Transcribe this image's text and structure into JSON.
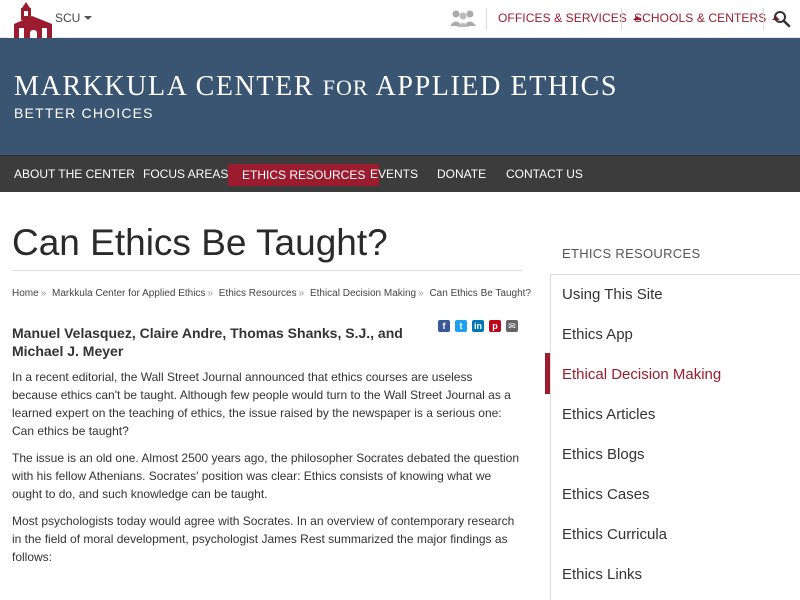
{
  "topbar": {
    "scu_label": "SCU",
    "offices_label": "OFFICES & SERVICES",
    "schools_label": "SCHOOLS & CENTERS"
  },
  "banner": {
    "title_part1": "MARKKULA CENTER ",
    "title_for": "FOR",
    "title_part2": " APPLIED ETHICS",
    "subtitle": "BETTER CHOICES"
  },
  "nav": {
    "items": [
      "ABOUT THE CENTER",
      "FOCUS AREAS",
      "ETHICS RESOURCES",
      "EVENTS",
      "DONATE",
      "CONTACT US"
    ],
    "active": "ETHICS RESOURCES"
  },
  "article": {
    "title": "Can Ethics Be Taught?",
    "breadcrumbs": [
      "Home",
      "Markkula Center for Applied Ethics",
      "Ethics Resources",
      "Ethical Decision Making",
      "Can Ethics Be Taught?"
    ],
    "authors": "Manuel Velasquez, Claire Andre, Thomas Shanks, S.J., and Michael J. Meyer",
    "paragraphs": [
      "In a recent editorial, the Wall Street Journal announced that ethics courses are useless because ethics can't be taught. Although few people would turn to the Wall Street Journal as a learned expert on the teaching of ethics, the issue raised by the newspaper is a serious one: Can ethics be taught?",
      "The issue is an old one. Almost 2500 years ago, the philosopher Socrates debated the question with his fellow Athenians. Socrates' position was clear: Ethics consists of knowing what we ought to do, and such knowledge can be taught.",
      "Most psychologists today would agree with Socrates. In an overview of contemporary research in the field of moral development, psychologist James Rest summarized the major findings as follows:"
    ]
  },
  "share_icons": [
    "facebook-icon",
    "twitter-icon",
    "linkedin-icon",
    "pinterest-icon",
    "email-icon"
  ],
  "sidebar": {
    "heading": "ETHICS RESOURCES",
    "items": [
      "Using This Site",
      "Ethics App",
      "Ethical Decision Making",
      "Ethics Articles",
      "Ethics Blogs",
      "Ethics Cases",
      "Ethics Curricula",
      "Ethics Links"
    ],
    "active_index": 2
  },
  "colors": {
    "accent": "#9b1c2e",
    "banner": "#3a5572",
    "nav": "#3c3c3c"
  }
}
